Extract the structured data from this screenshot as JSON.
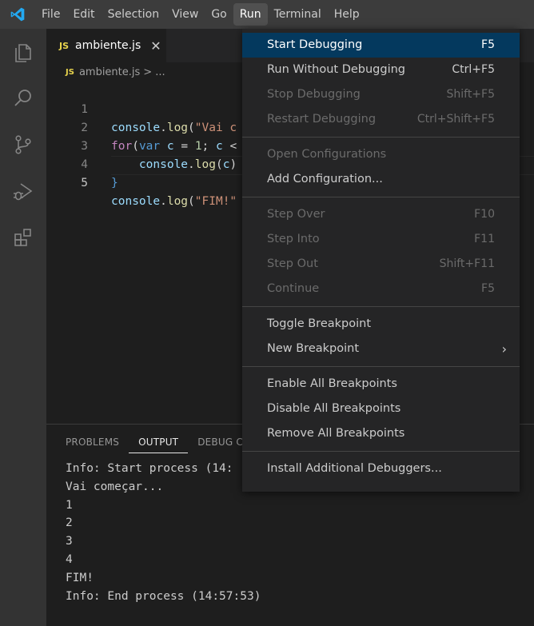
{
  "menubar": {
    "items": [
      "File",
      "Edit",
      "Selection",
      "View",
      "Go",
      "Run",
      "Terminal",
      "Help"
    ],
    "active_index": 5
  },
  "activity_bar": {
    "icons": [
      "explorer-icon",
      "search-icon",
      "source-control-icon",
      "run-debug-icon",
      "extensions-icon"
    ]
  },
  "tab": {
    "badge": "JS",
    "label": "ambiente.js",
    "close": "✕"
  },
  "breadcrumb": {
    "badge": "JS",
    "file": "ambiente.js",
    "separator": ">",
    "rest": "..."
  },
  "editor": {
    "line_numbers": [
      "1",
      "2",
      "3",
      "4",
      "5"
    ],
    "current_line": "5"
  },
  "panel": {
    "tabs": [
      "PROBLEMS",
      "OUTPUT",
      "DEBUG C"
    ],
    "active_tab": "OUTPUT",
    "output_lines": [
      "Info: Start process (14:",
      "Vai começar...",
      "1",
      "2",
      "3",
      "4",
      "FIM!",
      "Info: End process (14:57:53)"
    ]
  },
  "run_menu": {
    "groups": [
      [
        {
          "label": "Start Debugging",
          "key": "F5",
          "state": "selected"
        },
        {
          "label": "Run Without Debugging",
          "key": "Ctrl+F5",
          "state": "enabled"
        },
        {
          "label": "Stop Debugging",
          "key": "Shift+F5",
          "state": "disabled"
        },
        {
          "label": "Restart Debugging",
          "key": "Ctrl+Shift+F5",
          "state": "disabled"
        }
      ],
      [
        {
          "label": "Open Configurations",
          "key": "",
          "state": "disabled"
        },
        {
          "label": "Add Configuration...",
          "key": "",
          "state": "enabled"
        }
      ],
      [
        {
          "label": "Step Over",
          "key": "F10",
          "state": "disabled"
        },
        {
          "label": "Step Into",
          "key": "F11",
          "state": "disabled"
        },
        {
          "label": "Step Out",
          "key": "Shift+F11",
          "state": "disabled"
        },
        {
          "label": "Continue",
          "key": "F5",
          "state": "disabled"
        }
      ],
      [
        {
          "label": "Toggle Breakpoint",
          "key": "",
          "state": "enabled"
        },
        {
          "label": "New Breakpoint",
          "key": "",
          "state": "enabled",
          "submenu": "›"
        }
      ],
      [
        {
          "label": "Enable All Breakpoints",
          "key": "",
          "state": "enabled"
        },
        {
          "label": "Disable All Breakpoints",
          "key": "",
          "state": "enabled"
        },
        {
          "label": "Remove All Breakpoints",
          "key": "",
          "state": "enabled"
        }
      ],
      [
        {
          "label": "Install Additional Debuggers...",
          "key": "",
          "state": "enabled"
        }
      ]
    ]
  },
  "colors": {
    "accent_selected": "#04395e",
    "logo_blue": "#23a9f2",
    "js_badge": "#e8d44d"
  }
}
